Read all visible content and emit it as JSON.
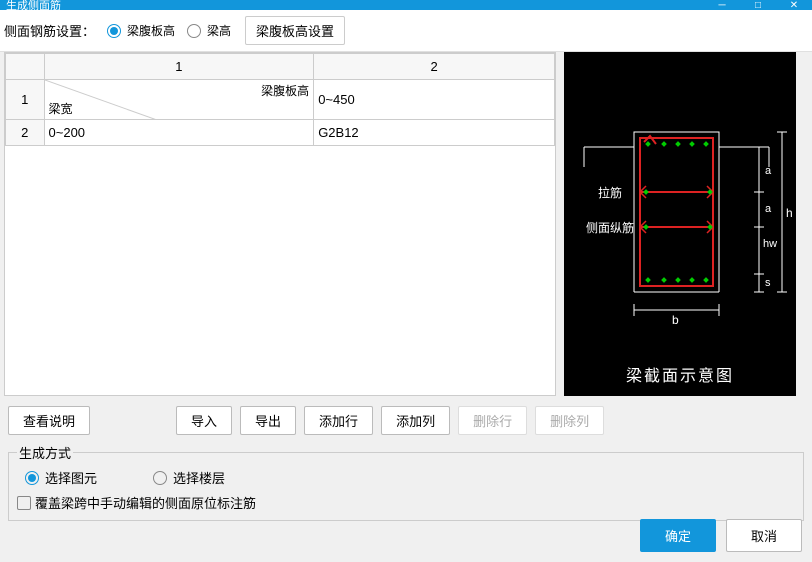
{
  "window": {
    "title": "生成侧面筋"
  },
  "toolbar": {
    "label": "侧面钢筋设置：",
    "radio1": "梁腹板高",
    "radio2": "梁高",
    "configBtn": "梁腹板高设置"
  },
  "grid": {
    "colHeads": [
      "1",
      "2"
    ],
    "diagTop": "梁腹板高",
    "diagBottom": "梁宽",
    "rows": [
      {
        "idx": "1",
        "c1": "",
        "c2": "0~450"
      },
      {
        "idx": "2",
        "c1": "0~200",
        "c2": "G2B12"
      }
    ]
  },
  "diagram": {
    "label_lajin": "拉筋",
    "label_cemian": "侧面纵筋",
    "dim_a1": "a",
    "dim_a2": "a",
    "dim_hw": "hw",
    "dim_h": "h",
    "dim_s": "s",
    "dim_b": "b",
    "caption": "梁截面示意图"
  },
  "buttons": {
    "viewHelp": "查看说明",
    "import": "导入",
    "export": "导出",
    "addRow": "添加行",
    "addCol": "添加列",
    "delRow": "删除行",
    "delCol": "删除列"
  },
  "generateMode": {
    "legend": "生成方式",
    "radioSelElem": "选择图元",
    "radioSelFloor": "选择楼层",
    "checkboxOverride": "覆盖梁跨中手动编辑的侧面原位标注筋"
  },
  "footer": {
    "ok": "确定",
    "cancel": "取消"
  }
}
